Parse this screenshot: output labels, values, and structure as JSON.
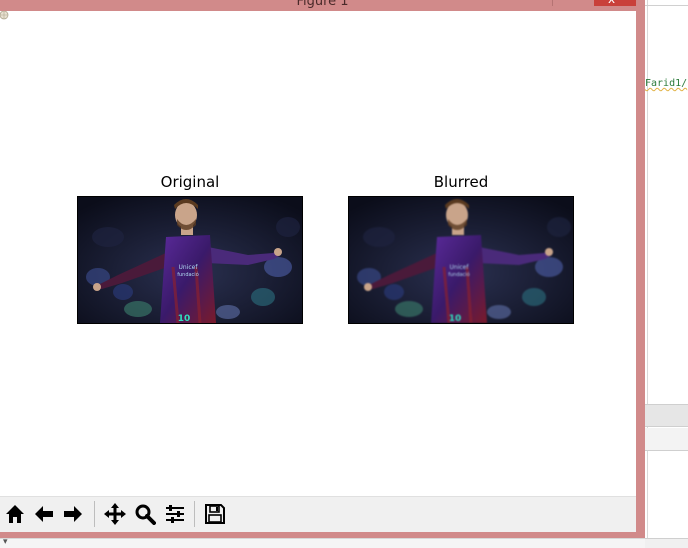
{
  "window": {
    "title": "Figure 1",
    "close_glyph": "x"
  },
  "figure": {
    "subplots": [
      {
        "title": "Original",
        "jersey_number": "10",
        "sponsor": "Unicef\nfundació"
      },
      {
        "title": "Blurred",
        "jersey_number": "10",
        "sponsor": "Unicef\nfundació"
      }
    ]
  },
  "toolbar": {
    "buttons": [
      {
        "name": "home",
        "icon": "home-icon"
      },
      {
        "name": "back",
        "icon": "arrow-left-icon"
      },
      {
        "name": "forward",
        "icon": "arrow-right-icon"
      },
      {
        "name": "pan",
        "icon": "move-icon"
      },
      {
        "name": "zoom",
        "icon": "magnifier-icon"
      },
      {
        "name": "subplots",
        "icon": "sliders-icon"
      },
      {
        "name": "save",
        "icon": "floppy-icon"
      }
    ]
  },
  "editor": {
    "code_fragment": "Farid1/"
  },
  "colors": {
    "frame": "#d18a8a",
    "close_button": "#c9403a",
    "toolbar": "#f0f0f0",
    "jersey_purple": "#4a2a8a",
    "jersey_red": "#8a2030"
  }
}
